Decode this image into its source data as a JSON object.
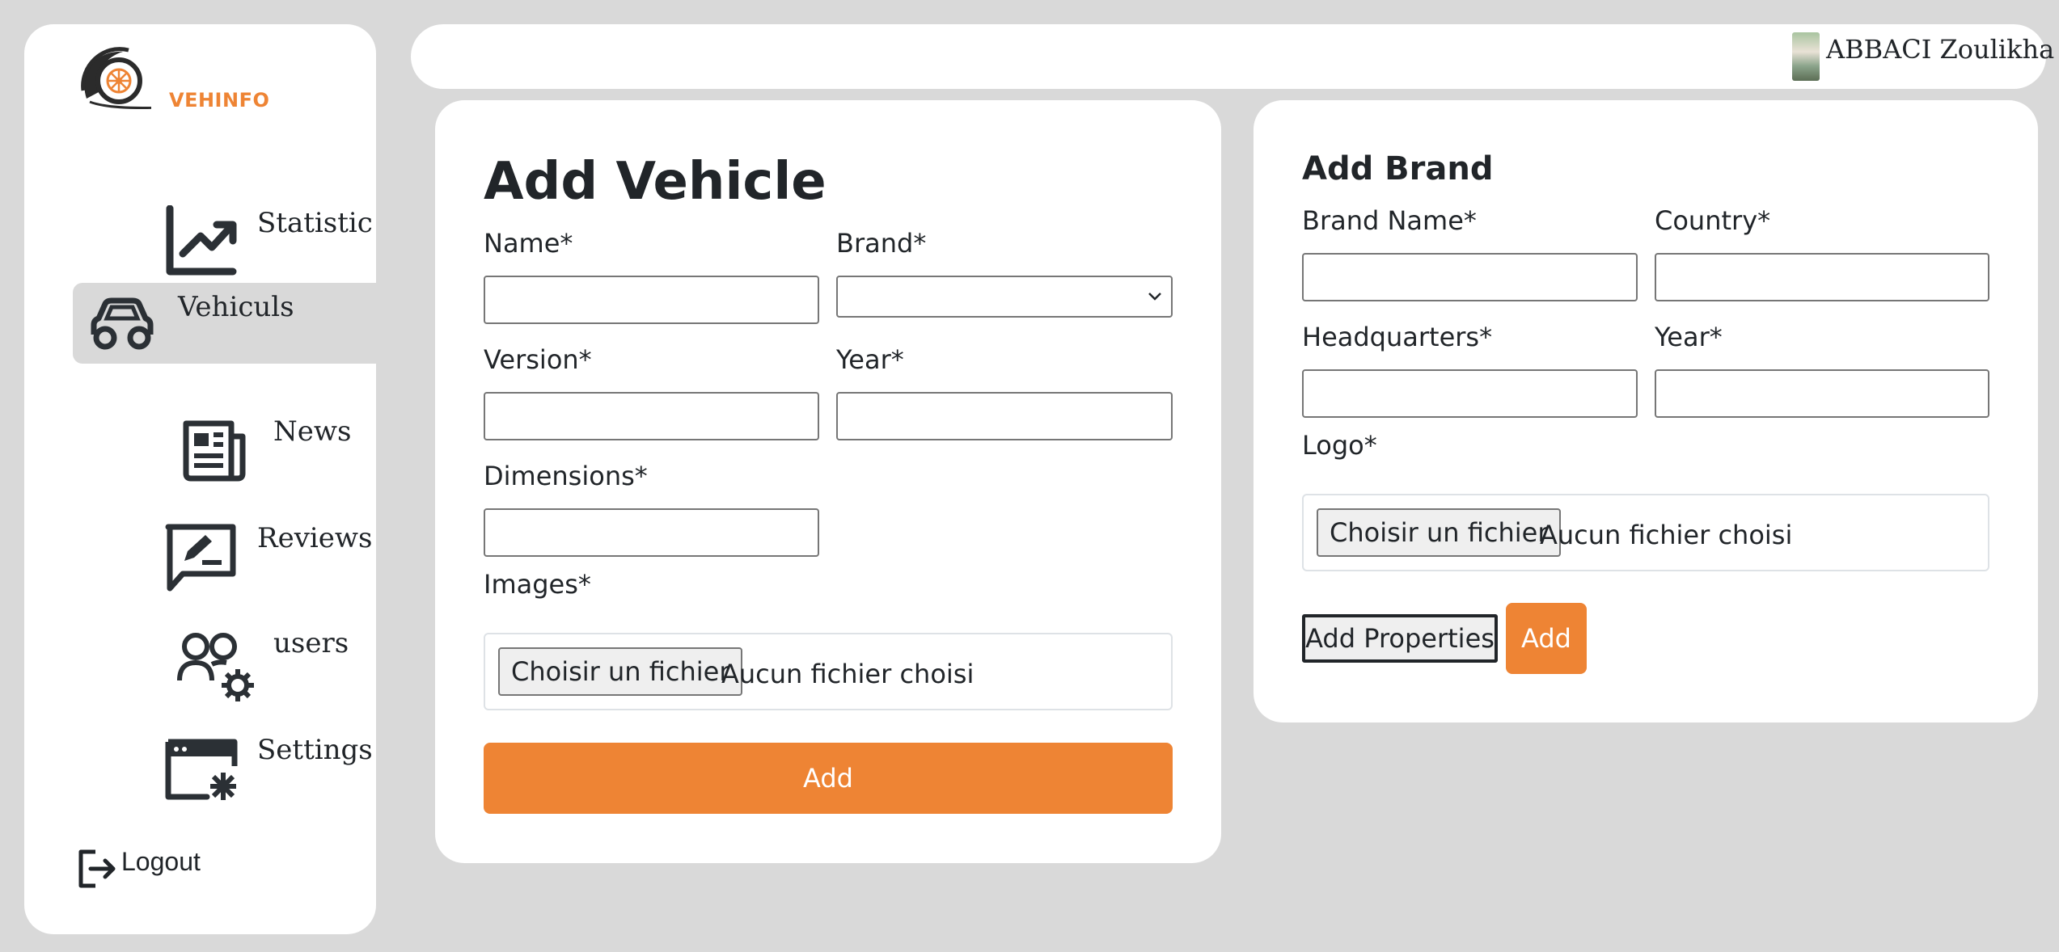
{
  "brand": {
    "name": "VEHINFO",
    "accent": "#ee8434"
  },
  "sidebar": {
    "items": [
      {
        "label": "Statistic",
        "icon": "chart-line-icon"
      },
      {
        "label": "Vehiculs",
        "icon": "car-icon",
        "active": true
      },
      {
        "label": "News",
        "icon": "newspaper-icon"
      },
      {
        "label": "Reviews",
        "icon": "chat-pen-icon"
      },
      {
        "label": "users",
        "icon": "users-gear-icon"
      },
      {
        "label": "Settings",
        "icon": "browser-gear-icon"
      }
    ],
    "logout": "Logout"
  },
  "topbar": {
    "user_name": "ABBACI Zoulikha"
  },
  "vehicle_form": {
    "title": "Add Vehicle",
    "name_label": "Name*",
    "brand_label": "Brand*",
    "version_label": "Version*",
    "year_label": "Year*",
    "dimensions_label": "Dimensions*",
    "images_label": "Images*",
    "file_button": "Choisir un fichier",
    "file_status": "Aucun fichier choisi",
    "submit": "Add"
  },
  "brand_form": {
    "title": "Add Brand",
    "brand_name_label": "Brand Name*",
    "country_label": "Country*",
    "headquarters_label": "Headquarters*",
    "year_label": "Year*",
    "logo_label": "Logo*",
    "file_button": "Choisir un fichier",
    "file_status": "Aucun fichier choisi",
    "properties_button": "Add Properties",
    "submit": "Add"
  }
}
